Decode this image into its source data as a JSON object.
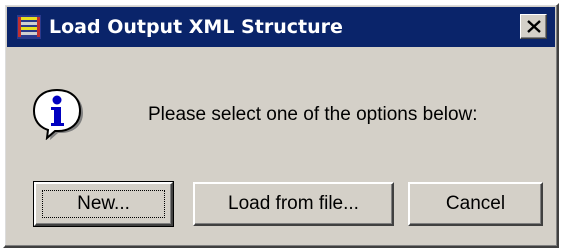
{
  "dialog": {
    "title": "Load Output XML Structure",
    "app_icon": "xml-structure-icon",
    "close_icon": "close-icon",
    "message_icon": "info-icon",
    "message": "Please select one of the options below:"
  },
  "buttons": {
    "new_label": "New...",
    "load_label": "Load from file...",
    "cancel_label": "Cancel"
  },
  "colors": {
    "titlebar": "#0a246a",
    "dialog_bg": "#d4d0c8",
    "title_text": "#ffffff"
  }
}
